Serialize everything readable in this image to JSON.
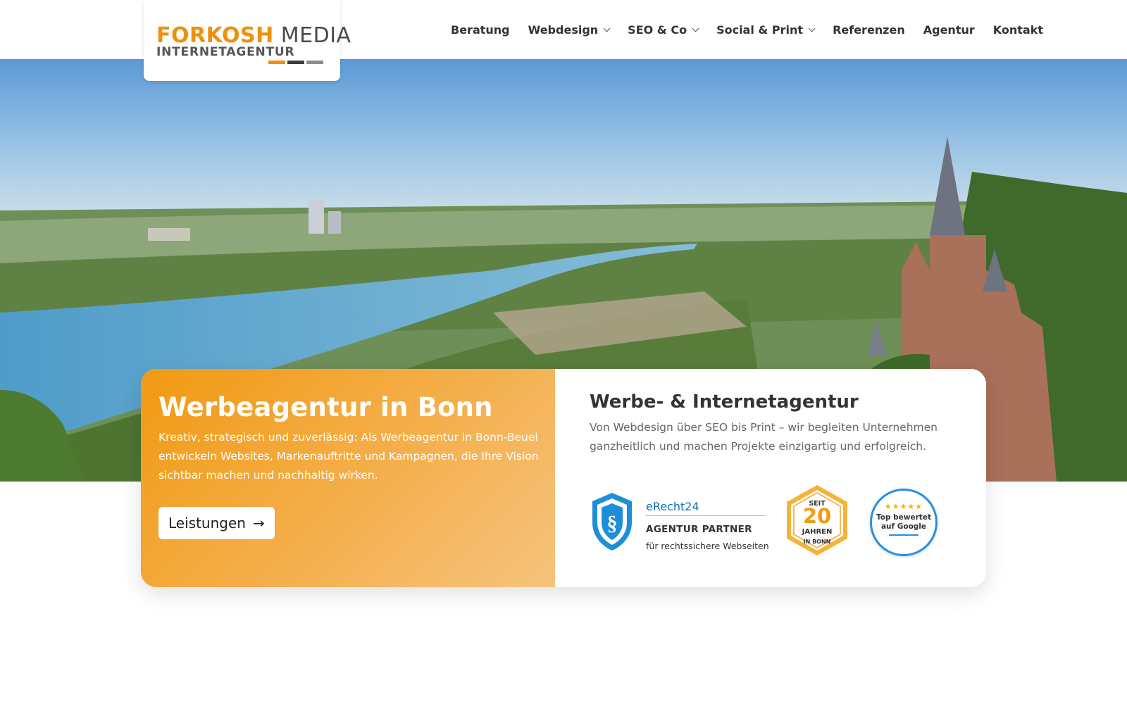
{
  "header": {
    "logo": {
      "brand": "FORKOSH",
      "media": "MEDIA",
      "subtitle": "INTERNETAGENTUR",
      "bar_colors": [
        "#f0900a",
        "#3c3c3c",
        "#8c8c8c"
      ]
    },
    "nav": [
      {
        "label": "Beratung",
        "dropdown": false
      },
      {
        "label": "Webdesign",
        "dropdown": true
      },
      {
        "label": "SEO & Co",
        "dropdown": true
      },
      {
        "label": "Social & Print",
        "dropdown": true
      },
      {
        "label": "Referenzen",
        "dropdown": false
      },
      {
        "label": "Agentur",
        "dropdown": false
      },
      {
        "label": "Kontakt",
        "dropdown": false
      }
    ]
  },
  "hero": {
    "image": "panorama-rhine-river-bonn-castle",
    "left": {
      "title": "Werbeagentur in Bonn",
      "text": "Kreativ, strategisch und zuverlässig: Als Werbeagentur in Bonn-Beuel entwickeln Websites, Markenauftritte und Kampagnen, die Ihre Vision sichtbar machen und nachhaltig wirken.",
      "button_label": "Leistungen",
      "button_icon": "arrow-right-icon"
    },
    "right": {
      "title": "Werbe- & Internetagentur",
      "text": "Von Webdesign über SEO bis Print – wir begleiten Unternehmen ganzheitlich und machen Projekte einzigartig und erfolgreich.",
      "badges": {
        "erecht": {
          "brand": "eRecht24",
          "title": "AGENTUR PARTNER",
          "subtitle": "für rechtssichere Webseiten"
        },
        "years": {
          "prefix": "SEIT",
          "number": "20",
          "unit": "JAHREN",
          "suffix": "IN BONN"
        },
        "google": {
          "stars": "★★★★★",
          "text": "Top bewertet auf Google"
        }
      }
    }
  },
  "colors": {
    "accent": "#f0900a",
    "erecht_blue": "#0d6fb6",
    "google_blue": "#2a8fde"
  }
}
